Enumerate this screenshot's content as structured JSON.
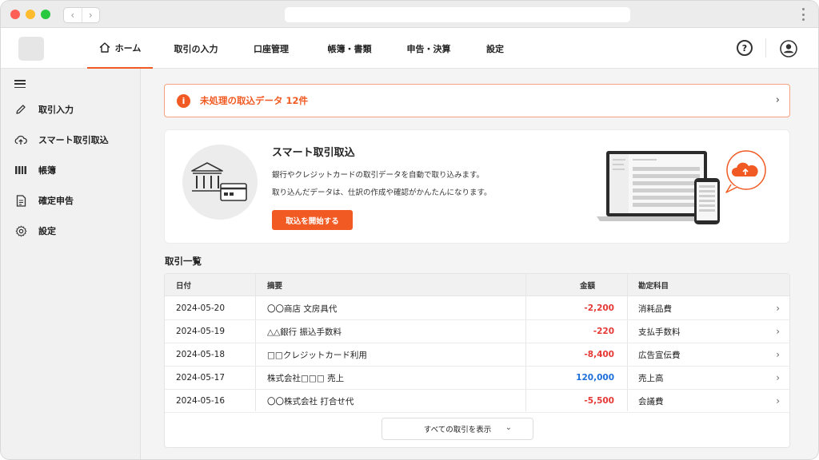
{
  "window": {
    "nav_back": "‹",
    "nav_forward": "›"
  },
  "topnav": {
    "tabs": [
      {
        "label": "ホーム",
        "active": true
      },
      {
        "label": "取引の入力"
      },
      {
        "label": "口座管理"
      },
      {
        "label": "帳簿・書類"
      },
      {
        "label": "申告・決算"
      },
      {
        "label": "設定"
      }
    ],
    "help_glyph": "?"
  },
  "sidebar": {
    "items": [
      {
        "label": "取引入力",
        "icon": "pencil-icon"
      },
      {
        "label": "スマート取引取込",
        "icon": "cloud-upload-icon"
      },
      {
        "label": "帳簿",
        "icon": "book-icon"
      },
      {
        "label": "確定申告",
        "icon": "document-icon"
      },
      {
        "label": "設定",
        "icon": "gear-icon"
      }
    ]
  },
  "alert": {
    "text": "未処理の取込データ 12件",
    "icon_glyph": "i",
    "chevron": "›"
  },
  "import_card": {
    "title": "スマート取引取込",
    "desc_line1": "銀行やクレジットカードの取引データを自動で取り込みます。",
    "desc_line2": "取り込んだデータは、仕訳の作成や確認がかんたんになります。",
    "button": "取込を開始する"
  },
  "transactions": {
    "title": "取引一覧",
    "columns": {
      "date": "日付",
      "summary": "摘要",
      "amount": "金額",
      "account": "勘定科目"
    },
    "rows": [
      {
        "date": "2024-05-20",
        "summary": "〇〇商店 文房具代",
        "amount": "-2,200",
        "account": "消耗品費"
      },
      {
        "date": "2024-05-19",
        "summary": "△△銀行 振込手数料",
        "amount": "-220",
        "account": "支払手数料"
      },
      {
        "date": "2024-05-18",
        "summary": "□□クレジットカード利用",
        "amount": "-8,400",
        "account": "広告宣伝費"
      },
      {
        "date": "2024-05-17",
        "summary": "株式会社□□□ 売上",
        "amount": "120,000",
        "account": "売上高"
      },
      {
        "date": "2024-05-16",
        "summary": "〇〇株式会社 打合せ代",
        "amount": "-5,500",
        "account": "会議費"
      }
    ],
    "row_chevron": "›",
    "show_all": "すべての取引を表示",
    "show_all_chevron": "⌄"
  },
  "colors": {
    "accent": "#f15a22",
    "negative": "#e53935",
    "positive": "#1e6fd9"
  }
}
